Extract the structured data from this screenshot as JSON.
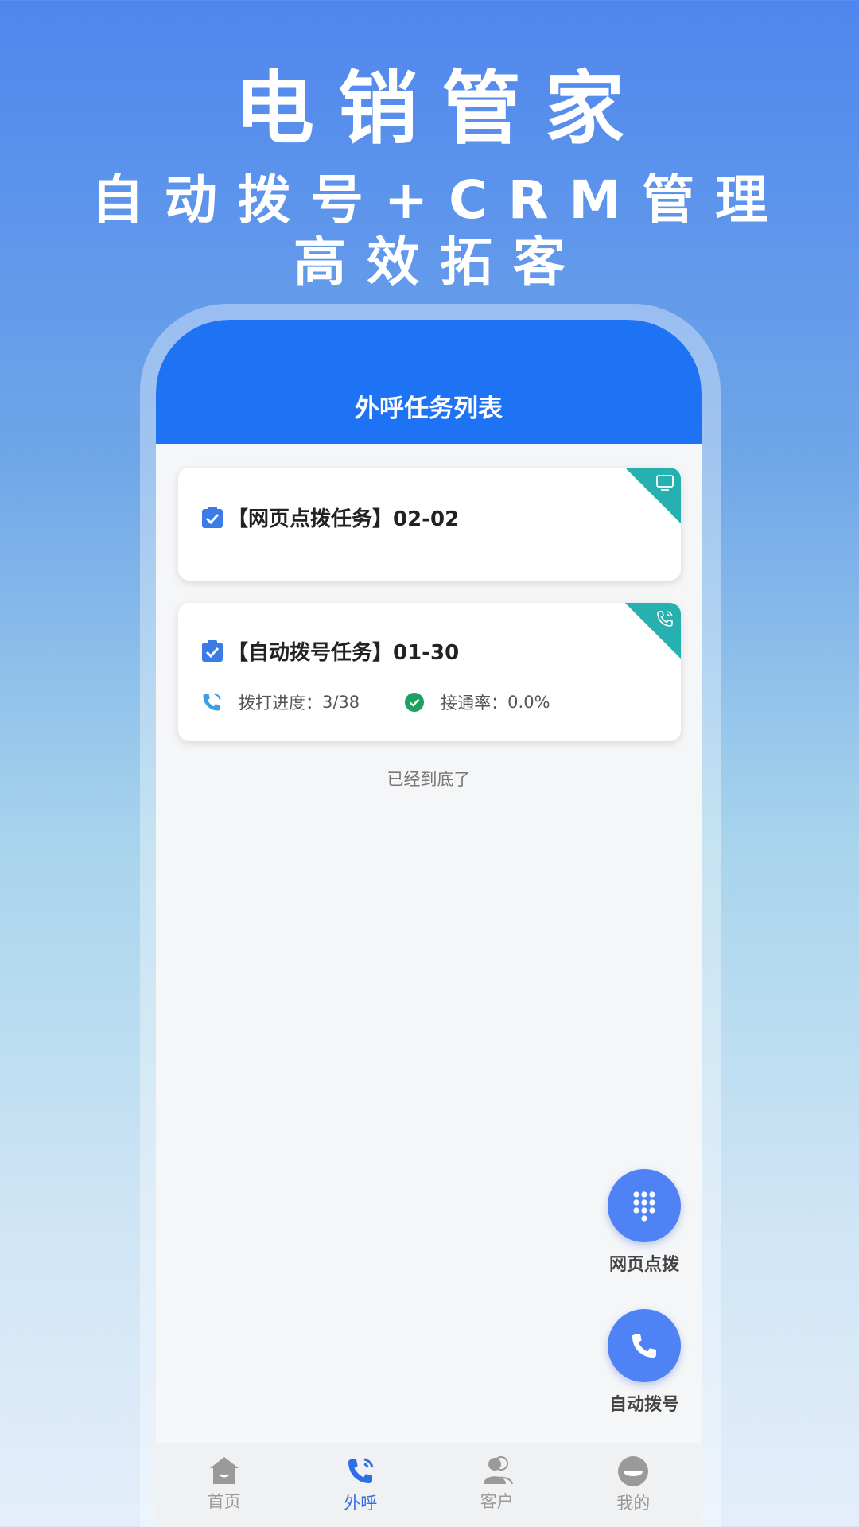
{
  "hero": {
    "title": "电销管家",
    "subtitle_line1": "自动拨号+CRM管理",
    "subtitle_line2": "高效拓客"
  },
  "app": {
    "header_title": "外呼任务列表",
    "tasks": [
      {
        "title": "【网页点拨任务】02-02",
        "corner_icon": "monitor-icon"
      },
      {
        "title": "【自动拨号任务】01-30",
        "corner_icon": "phone-icon",
        "progress_label": "拨打进度：",
        "progress_value": "3/38",
        "rate_label": "接通率：",
        "rate_value": "0.0%"
      }
    ],
    "end_text": "已经到底了",
    "fab_web_dial_label": "网页点拨",
    "fab_auto_dial_label": "自动拨号",
    "tabs": [
      {
        "label": "首页",
        "icon": "home-icon"
      },
      {
        "label": "外呼",
        "icon": "phone-icon"
      },
      {
        "label": "客户",
        "icon": "contacts-icon"
      },
      {
        "label": "我的",
        "icon": "profile-icon"
      }
    ],
    "active_tab": "外呼",
    "colors": {
      "primary": "#1e73f5",
      "fab": "#4f82f5",
      "corner": "#27b0b0",
      "success": "#1aa260"
    }
  }
}
